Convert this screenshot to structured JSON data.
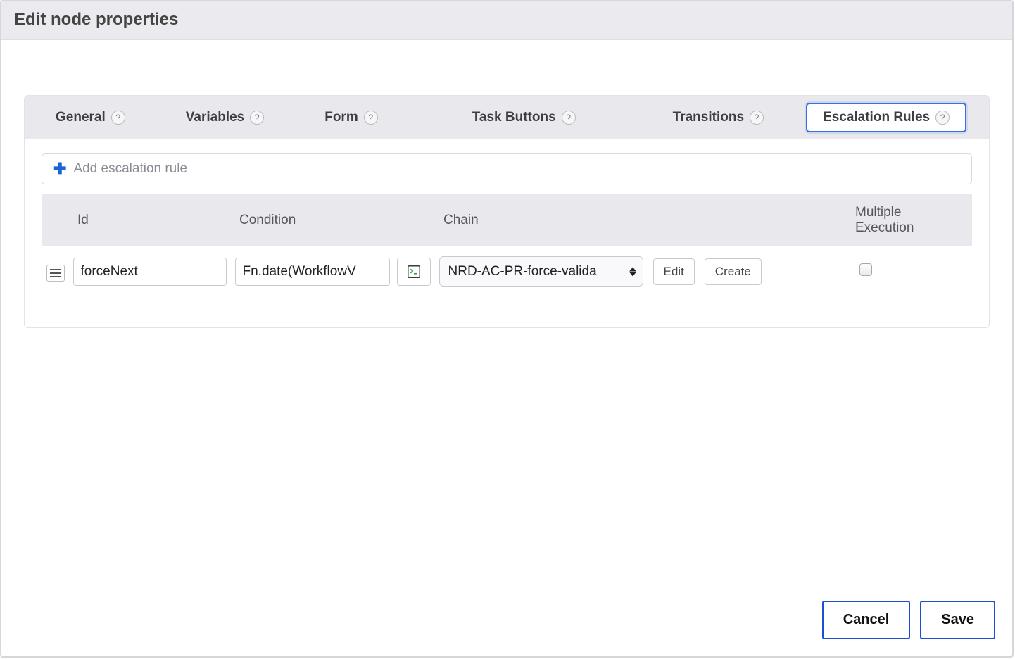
{
  "dialog": {
    "title": "Edit node properties"
  },
  "tabs": {
    "general": "General",
    "variables": "Variables",
    "form": "Form",
    "task_buttons": "Task Buttons",
    "transitions": "Transitions",
    "escalation_rules": "Escalation Rules"
  },
  "toolbar": {
    "add_rule_label": "Add escalation rule"
  },
  "table": {
    "headers": {
      "id": "Id",
      "condition": "Condition",
      "chain": "Chain",
      "multiple_execution": "Multiple Execution"
    },
    "rows": [
      {
        "id_value": "forceNext",
        "condition_value": "Fn.date(WorkflowV",
        "chain_selected": "NRD-AC-PR-force-valida",
        "edit_label": "Edit",
        "create_label": "Create",
        "multiple_execution_checked": false
      }
    ]
  },
  "footer": {
    "cancel_label": "Cancel",
    "save_label": "Save"
  }
}
